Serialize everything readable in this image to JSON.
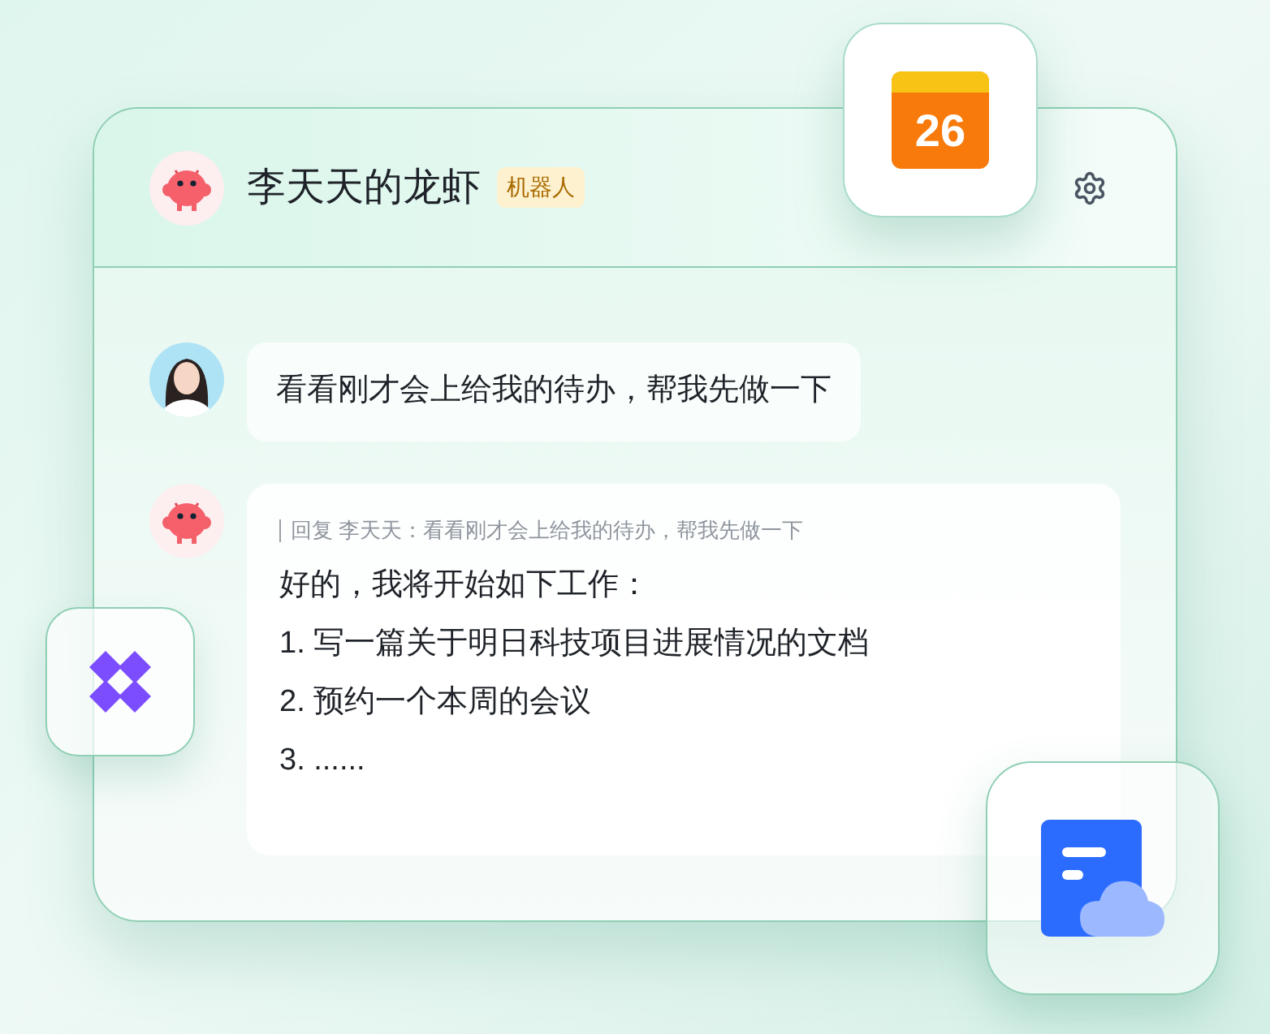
{
  "chat": {
    "title": "李天天的龙虾",
    "badge": "机器人",
    "messages": [
      {
        "kind": "user",
        "text": "看看刚才会上给我的待办，帮我先做一下"
      },
      {
        "kind": "bot",
        "quote": "回复 李天天：看看刚才会上给我的待办，帮我先做一下",
        "lines": [
          "好的，我将开始如下工作：",
          "1. 写一篇关于明日科技项目进展情况的文档",
          "2. 预约一个本周的会议",
          "3. ......"
        ]
      }
    ]
  },
  "floating_apps": [
    {
      "kind": "calendar",
      "date": "26"
    },
    {
      "kind": "diamond"
    },
    {
      "kind": "cloud-doc"
    }
  ]
}
